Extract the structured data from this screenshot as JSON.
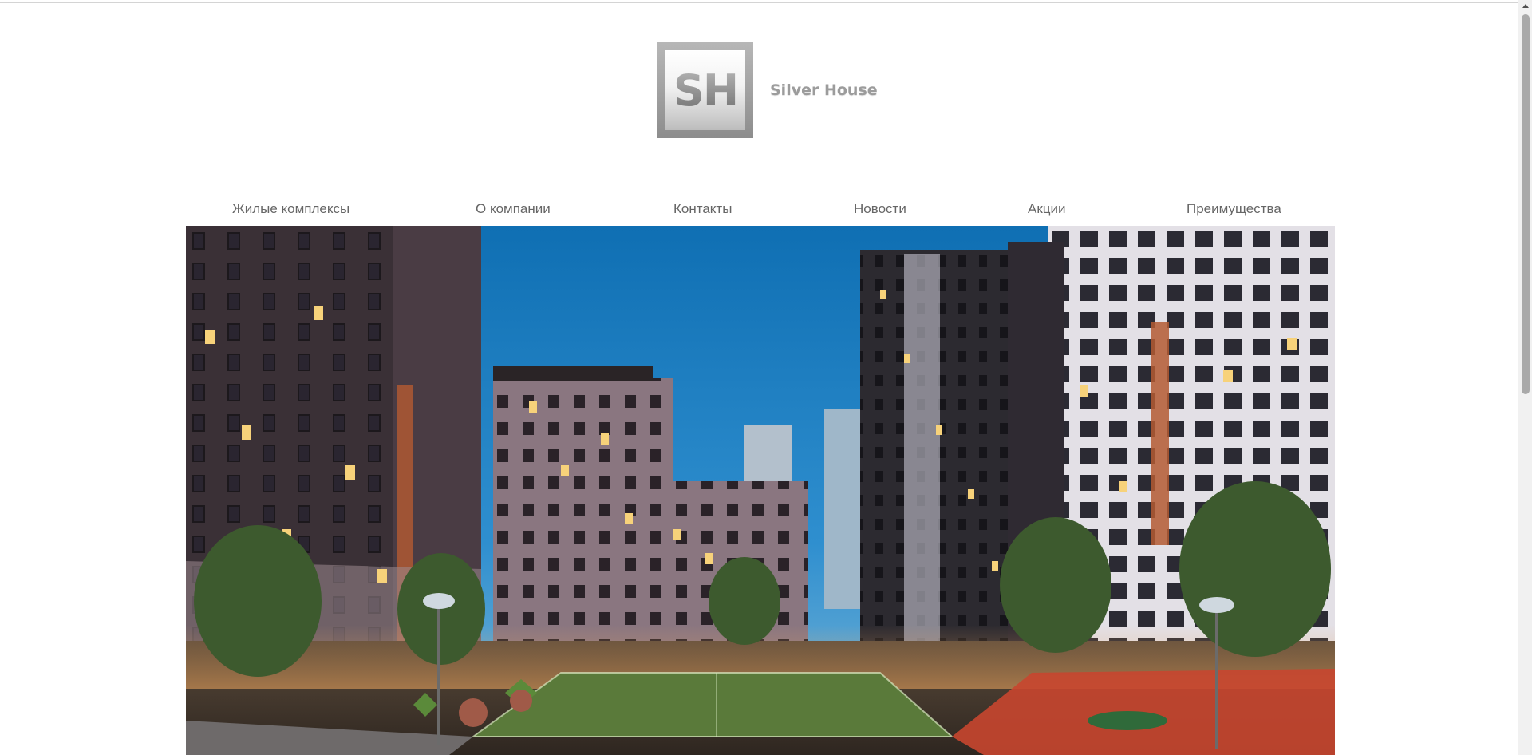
{
  "logo": {
    "monogram": "SH",
    "name": "Silver House"
  },
  "nav": {
    "items": [
      {
        "label": "Жилые комплексы"
      },
      {
        "label": "О компании"
      },
      {
        "label": "Контакты"
      },
      {
        "label": "Новости"
      },
      {
        "label": "Акции"
      },
      {
        "label": "Преимущества"
      }
    ]
  },
  "hero": {
    "description": "",
    "colors": {
      "sky": "#1f7fbf",
      "facade": "#3a3238",
      "window_lit": "#f7d27a",
      "court": "#5a7a3a",
      "playground": "#c8462f"
    }
  }
}
